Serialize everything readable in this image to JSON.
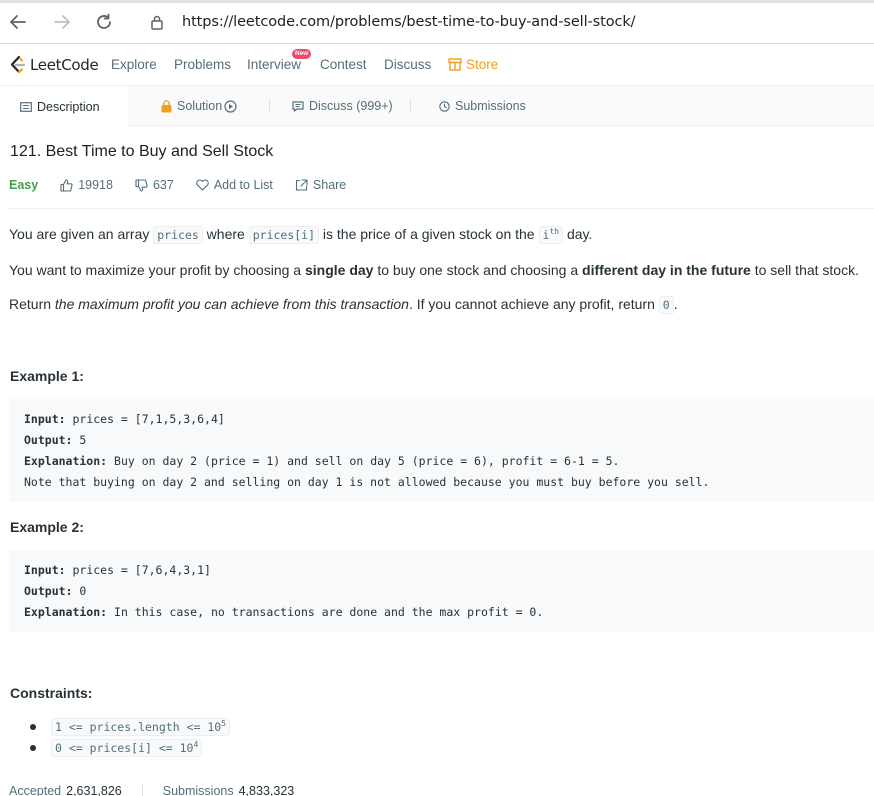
{
  "browser": {
    "url": "https://leetcode.com/problems/best-time-to-buy-and-sell-stock/"
  },
  "navbar": {
    "logo_text": "LeetCode",
    "items": [
      "Explore",
      "Problems",
      "Interview",
      "Contest",
      "Discuss"
    ],
    "new_badge": "New",
    "store_label": "Store",
    "store_color": "#f0a020"
  },
  "tabs": {
    "description": "Description",
    "solution": "Solution",
    "discuss": "Discuss (999+)",
    "submissions": "Submissions"
  },
  "problem": {
    "title": "121. Best Time to Buy and Sell Stock",
    "difficulty": "Easy",
    "difficulty_color": "#43a047",
    "likes": "19918",
    "dislikes": "637",
    "add_to_list": "Add to List",
    "share": "Share"
  },
  "description": {
    "p1": {
      "a": "You are given an array ",
      "code1": "prices",
      "b": " where ",
      "code2": "prices[i]",
      "c": " is the price of a given stock on the ",
      "code3": "i",
      "sup3": "th",
      "d": " day."
    },
    "p2": {
      "a": "You want to maximize your profit by choosing a ",
      "b1": "single day",
      "c": " to buy one stock and choosing a ",
      "b2": "different day in the future",
      "d": " to sell that stock."
    },
    "p3": {
      "italic": "the maximum profit you can achieve from this transaction",
      "a": "Return ",
      "b": ". If you cannot achieve any profit, return ",
      "code": "0",
      "c": "."
    }
  },
  "examples": [
    {
      "title": "Example 1:",
      "input_label": "Input:",
      "input": " prices = [7,1,5,3,6,4]",
      "output_label": "Output:",
      "output": " 5",
      "explanation_label": "Explanation:",
      "explanation": " Buy on day 2 (price = 1) and sell on day 5 (price = 6), profit = 6-1 = 5.",
      "note": "Note that buying on day 2 and selling on day 1 is not allowed because you must buy before you sell."
    },
    {
      "title": "Example 2:",
      "input_label": "Input:",
      "input": " prices = [7,6,4,3,1]",
      "output_label": "Output:",
      "output": " 0",
      "explanation_label": "Explanation:",
      "explanation": " In this case, no transactions are done and the max profit = 0."
    }
  ],
  "constraints": {
    "title": "Constraints:",
    "items": [
      {
        "code": "1 <= prices.length <= 10",
        "sup": "5"
      },
      {
        "code": "0 <= prices[i] <= 10",
        "sup": "4"
      }
    ]
  },
  "stats": {
    "accepted_label": "Accepted",
    "accepted_value": "2,631,826",
    "submissions_label": "Submissions",
    "submissions_value": "4,833,323"
  }
}
